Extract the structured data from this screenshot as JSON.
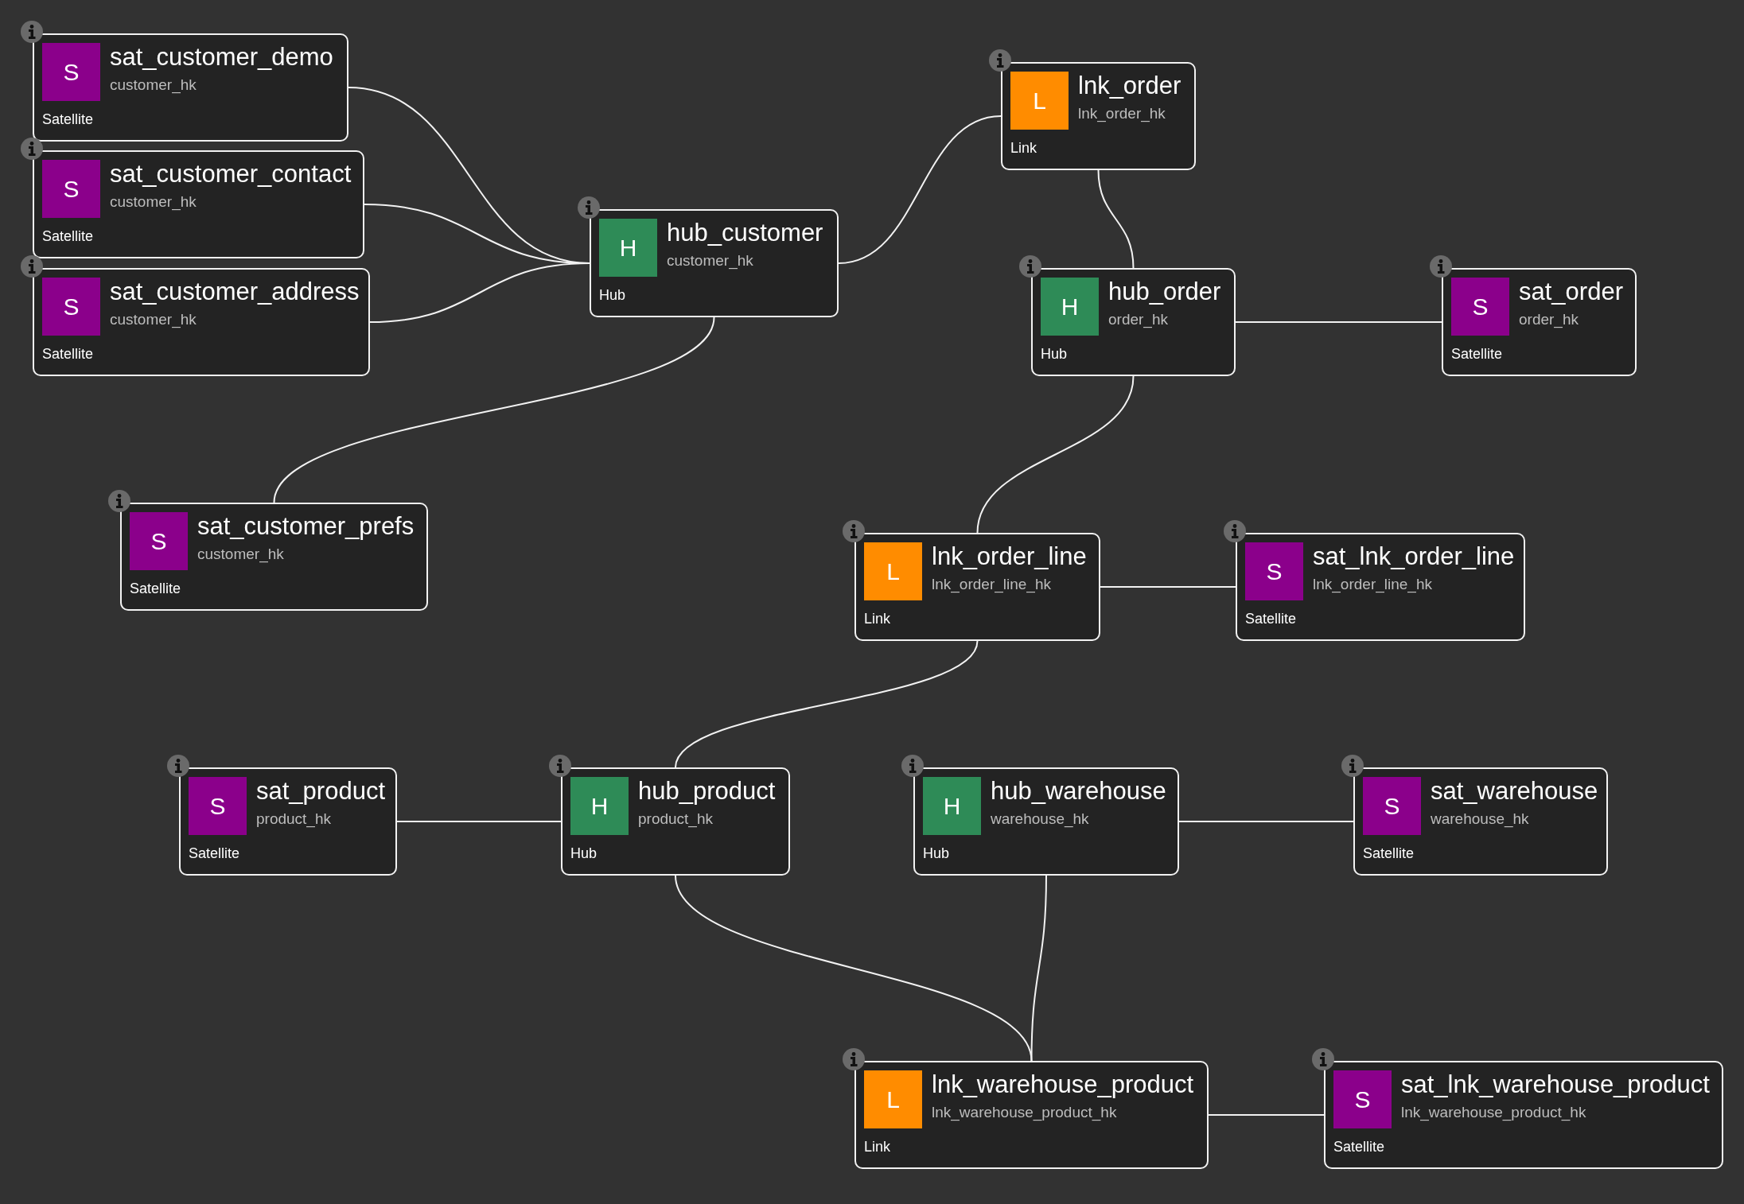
{
  "nodes": [
    {
      "kind": "satellite",
      "letter": "S",
      "title": "sat_customer_demo",
      "key": "customer_hk",
      "type_label": "Satellite"
    },
    {
      "kind": "satellite",
      "letter": "S",
      "title": "sat_customer_contact",
      "key": "customer_hk",
      "type_label": "Satellite"
    },
    {
      "kind": "satellite",
      "letter": "S",
      "title": "sat_customer_address",
      "key": "customer_hk",
      "type_label": "Satellite"
    },
    {
      "kind": "hub",
      "letter": "H",
      "title": "hub_customer",
      "key": "customer_hk",
      "type_label": "Hub"
    },
    {
      "kind": "link",
      "letter": "L",
      "title": "lnk_order",
      "key": "lnk_order_hk",
      "type_label": "Link"
    },
    {
      "kind": "hub",
      "letter": "H",
      "title": "hub_order",
      "key": "order_hk",
      "type_label": "Hub"
    },
    {
      "kind": "satellite",
      "letter": "S",
      "title": "sat_order",
      "key": "order_hk",
      "type_label": "Satellite"
    },
    {
      "kind": "satellite",
      "letter": "S",
      "title": "sat_customer_prefs",
      "key": "customer_hk",
      "type_label": "Satellite"
    },
    {
      "kind": "link",
      "letter": "L",
      "title": "lnk_order_line",
      "key": "lnk_order_line_hk",
      "type_label": "Link"
    },
    {
      "kind": "satellite",
      "letter": "S",
      "title": "sat_lnk_order_line",
      "key": "lnk_order_line_hk",
      "type_label": "Satellite"
    },
    {
      "kind": "satellite",
      "letter": "S",
      "title": "sat_product",
      "key": "product_hk",
      "type_label": "Satellite"
    },
    {
      "kind": "hub",
      "letter": "H",
      "title": "hub_product",
      "key": "product_hk",
      "type_label": "Hub"
    },
    {
      "kind": "hub",
      "letter": "H",
      "title": "hub_warehouse",
      "key": "warehouse_hk",
      "type_label": "Hub"
    },
    {
      "kind": "satellite",
      "letter": "S",
      "title": "sat_warehouse",
      "key": "warehouse_hk",
      "type_label": "Satellite"
    },
    {
      "kind": "link",
      "letter": "L",
      "title": "lnk_warehouse_product",
      "key": "lnk_warehouse_product_hk",
      "type_label": "Link"
    },
    {
      "kind": "satellite",
      "letter": "S",
      "title": "sat_lnk_warehouse_product",
      "key": "lnk_warehouse_product_hk",
      "type_label": "Satellite"
    }
  ]
}
